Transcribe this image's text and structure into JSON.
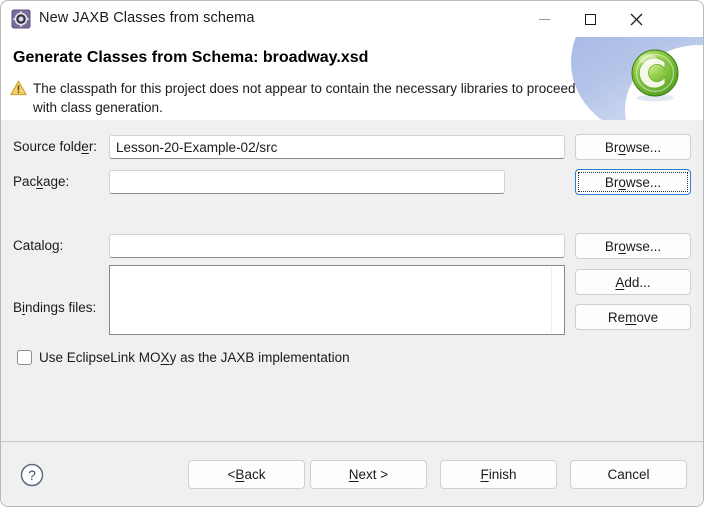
{
  "window": {
    "title": "New JAXB Classes from schema",
    "icon": "jaxb-wizard-icon",
    "controls": {
      "minimize": "minimize-icon",
      "maximize": "maximize-icon",
      "close": "close-icon"
    }
  },
  "banner": {
    "title": "Generate Classes from Schema: broadway.xsd",
    "message": "The classpath for this project does not appear to contain the necessary libraries to proceed with class generation.",
    "warning_icon": "warning-icon",
    "logo_icon": "green-c-logo-icon",
    "accent_color": "#9fb4e2",
    "warning_color": "#e8b23a",
    "logo_color": "#7dc242"
  },
  "form": {
    "source_folder": {
      "label_pre": "Source fold",
      "label_mnemonic": "e",
      "label_post": "r:",
      "value": "Lesson-20-Example-02/src",
      "placeholder": "",
      "browse_pre": "Br",
      "browse_mnemonic": "o",
      "browse_post": "wse..."
    },
    "package": {
      "label_pre": "Pac",
      "label_mnemonic": "k",
      "label_post": "age:",
      "value": "",
      "placeholder": "",
      "browse_pre": "Br",
      "browse_mnemonic": "o",
      "browse_post": "wse..."
    },
    "catalog": {
      "label_pre": "Catalo",
      "label_mnemonic": "g",
      "label_post": ":",
      "value": "",
      "placeholder": "",
      "browse_pre": "Br",
      "browse_mnemonic": "o",
      "browse_post": "wse..."
    },
    "bindings": {
      "label_pre": "B",
      "label_mnemonic": "i",
      "label_post": "ndings files:",
      "items": [],
      "add_pre": "",
      "add_mnemonic": "A",
      "add_post": "dd...",
      "remove_pre": "Re",
      "remove_mnemonic": "m",
      "remove_post": "ove"
    },
    "moxy_checkbox": {
      "checked": false,
      "label_pre": "Use EclipseLink MO",
      "label_mnemonic": "X",
      "label_post": "y as the JAXB implementation"
    }
  },
  "footer": {
    "help_icon": "help-icon",
    "back_pre": "< ",
    "back_mnemonic": "B",
    "back_post": "ack",
    "next_pre": "",
    "next_mnemonic": "N",
    "next_post": "ext >",
    "finish_pre": "",
    "finish_mnemonic": "F",
    "finish_post": "inish",
    "cancel_label": "Cancel"
  }
}
